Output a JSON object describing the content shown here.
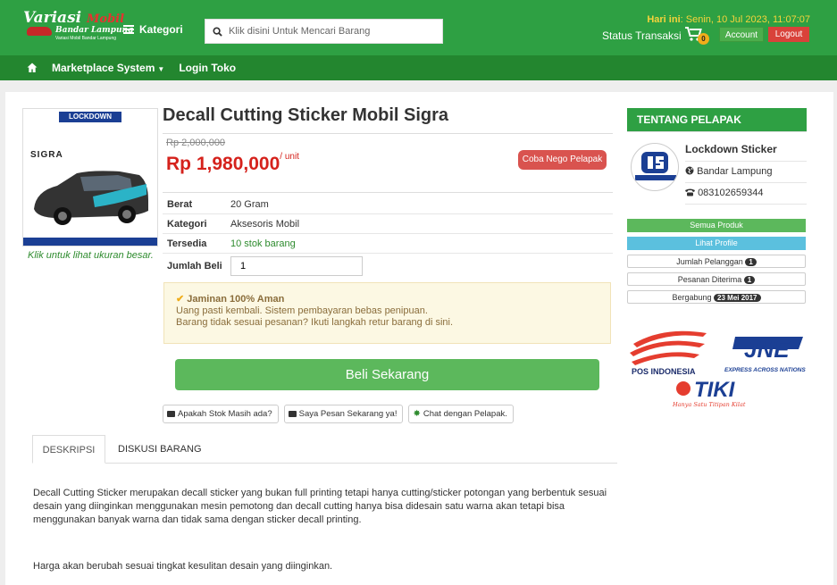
{
  "header": {
    "logo_title": "Variasi",
    "logo_title_red": "Mobil",
    "logo_subtitle": "Bandar Lampung",
    "logo_tagline": "Variasi Mobil Bandar Lampung",
    "kategori_label": "Kategori",
    "search_placeholder": "Klik disini Untuk Mencari Barang",
    "date_label": "Hari ini",
    "date_value": ": Senin, 10 Jul 2023, 11:07:07",
    "status_label": "Status Transaksi",
    "cart_count": "0",
    "account_label": "Account",
    "logout_label": "Logout"
  },
  "nav": {
    "items": [
      "Marketplace System",
      "Login Toko"
    ]
  },
  "product": {
    "title": "Decall Cutting Sticker Mobil Sigra",
    "old_price": "Rp 2,000,000",
    "price": "Rp 1,980,000",
    "unit": "/ unit",
    "nego_label": "Coba Nego Pelapak",
    "image_caption": "Klik untuk lihat ukuran besar.",
    "image_brand": "LOCKDOWN",
    "image_model": "SIGRA",
    "specs": [
      {
        "label": "Berat",
        "value": "20 Gram"
      },
      {
        "label": "Kategori",
        "value": "Aksesoris Mobil"
      },
      {
        "label": "Tersedia",
        "value": "10 stok barang"
      }
    ],
    "qty_label": "Jumlah Beli",
    "qty_value": "1",
    "guarantee_title": "Jaminan 100% Aman",
    "guarantee_line1": "Uang pasti kembali. Sistem pembayaran bebas penipuan.",
    "guarantee_line2": "Barang tidak sesuai pesanan? Ikuti langkah retur barang di sini.",
    "buy_label": "Beli Sekarang",
    "mini_buttons": [
      "Apakah Stok Masih ada?",
      "Saya Pesan Sekarang ya!",
      "Chat dengan Pelapak."
    ]
  },
  "tabs": {
    "items": [
      "DESKRIPSI",
      "DISKUSI BARANG"
    ],
    "description": "Decall Cutting Sticker merupakan decall sticker yang bukan full printing tetapi hanya cutting/sticker potongan yang berbentuk sesuai desain yang diinginkan menggunakan mesin pemotong dan decall cutting hanya bisa didesain satu warna akan tetapi bisa menggunakan banyak warna dan tidak sama dengan sticker decall printing.",
    "description2": "Harga akan berubah sesuai tingkat kesulitan desain yang diinginkan."
  },
  "seller": {
    "section_title": "TENTANG PELAPAK",
    "name": "Lockdown Sticker",
    "location": "Bandar Lampung",
    "phone": "083102659344",
    "logo_text": "LOCKDOWN STICKER",
    "all_products": "Semua Produk",
    "view_profile": "Lihat Profile",
    "customers_label": "Jumlah Pelanggan",
    "customers_count": "1",
    "orders_label": "Pesanan Diterima",
    "orders_count": "1",
    "joined_label": "Bergabung",
    "joined_date": "23 Mei 2017"
  },
  "couriers": {
    "pos": "POS INDONESIA",
    "jne": "JNE",
    "jne_tagline": "EXPRESS ACROSS NATIONS",
    "tiki": "TIKI",
    "tiki_tagline": "Hanya Satu Titipan Kilat"
  },
  "colors": {
    "header_green": "#2ea043",
    "nav_green": "#23862f",
    "price_red": "#d5221c",
    "buy_green": "#5cb85c"
  }
}
